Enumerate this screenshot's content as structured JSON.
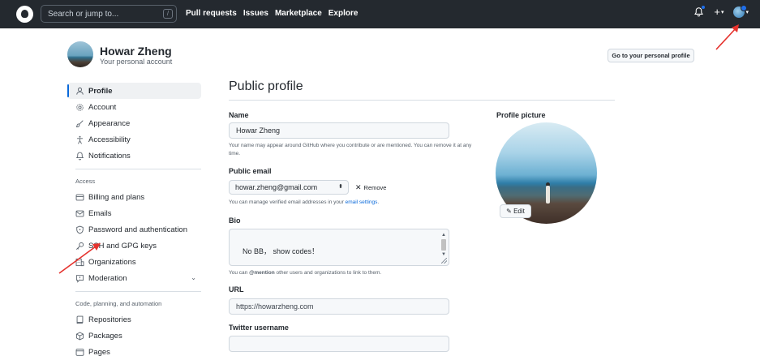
{
  "header": {
    "search_placeholder": "Search or jump to...",
    "search_shortcut": "/",
    "nav": [
      "Pull requests",
      "Issues",
      "Marketplace",
      "Explore"
    ],
    "plus": "+",
    "caret": "▾"
  },
  "user": {
    "name": "Howar Zheng",
    "subtitle": "Your personal account",
    "profile_button": "Go to your personal profile"
  },
  "sidebar": {
    "items_top": [
      {
        "label": "Profile",
        "icon": "person-icon",
        "active": true
      },
      {
        "label": "Account",
        "icon": "gear-icon"
      },
      {
        "label": "Appearance",
        "icon": "paintbrush-icon"
      },
      {
        "label": "Accessibility",
        "icon": "accessibility-icon"
      },
      {
        "label": "Notifications",
        "icon": "bell-icon"
      }
    ],
    "section_access": "Access",
    "items_access": [
      {
        "label": "Billing and plans",
        "icon": "credit-card-icon"
      },
      {
        "label": "Emails",
        "icon": "mail-icon"
      },
      {
        "label": "Password and authentication",
        "icon": "shield-lock-icon"
      },
      {
        "label": "SSH and GPG keys",
        "icon": "key-icon"
      },
      {
        "label": "Organizations",
        "icon": "organization-icon"
      },
      {
        "label": "Moderation",
        "icon": "report-icon"
      }
    ],
    "moderation_chevron": "⌄",
    "section_code": "Code, planning, and automation",
    "items_code": [
      {
        "label": "Repositories",
        "icon": "repo-icon"
      },
      {
        "label": "Packages",
        "icon": "package-icon"
      },
      {
        "label": "Pages",
        "icon": "browser-icon"
      }
    ]
  },
  "main": {
    "title": "Public profile",
    "name_label": "Name",
    "name_value": "Howar Zheng",
    "name_note": "Your name may appear around GitHub where you contribute or are mentioned. You can remove it at any time.",
    "email_label": "Public email",
    "email_value": "howar.zheng@gmail.com",
    "email_remove": "Remove",
    "email_note": "You can manage verified email addresses in your",
    "email_note_link": "email settings",
    "email_note_end": ".",
    "bio_label": "Bio",
    "bio_value": "No BB， show codes！",
    "bio_note_mention": "@mention",
    "bio_note": " other users and organizations to link to them.",
    "bio_note_start": "You can ",
    "url_label": "URL",
    "url_value": "https://howarzheng.com",
    "twitter_label": "Twitter username",
    "twitter_value": ""
  },
  "profile_picture": {
    "label": "Profile picture",
    "edit": "Edit"
  },
  "colors": {
    "header_bg": "#24292f",
    "accent": "#0969da",
    "annotation_arrow": "#e5322d"
  }
}
